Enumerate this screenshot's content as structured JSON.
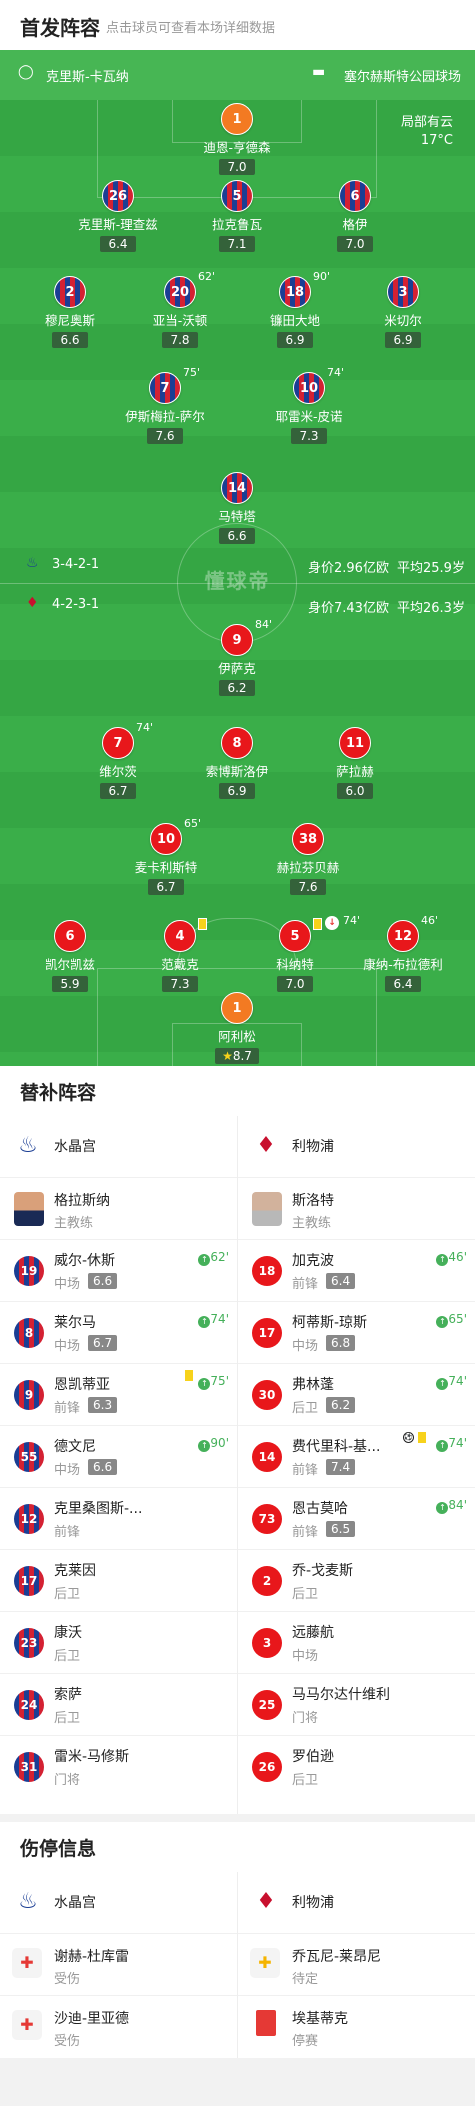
{
  "header": {
    "title": "首发阵容",
    "subtitle": "点击球员可查看本场详细数据"
  },
  "pitch": {
    "home_team": "克里斯-卡瓦纳",
    "away_team": "塞尔赫斯特公园球场",
    "weather": "局部有云",
    "temperature": "17°C",
    "watermark": "懂球帝",
    "home_formation": "3-4-2-1",
    "home_value": "身价2.96亿欧",
    "home_age": "平均25.9岁",
    "away_formation": "4-2-3-1",
    "away_value": "身价7.43亿欧",
    "away_age": "平均26.3岁",
    "home_players": [
      {
        "num": "1",
        "name": "迪恩-亨德森",
        "rating": "7.0"
      },
      {
        "num": "26",
        "name": "克里斯-理查兹",
        "rating": "6.4"
      },
      {
        "num": "5",
        "name": "拉克鲁瓦",
        "rating": "7.1"
      },
      {
        "num": "6",
        "name": "格伊",
        "rating": "7.0"
      },
      {
        "num": "2",
        "name": "穆尼奥斯",
        "rating": "6.6"
      },
      {
        "num": "20",
        "name": "亚当-沃顿",
        "rating": "7.8",
        "sub": "62'"
      },
      {
        "num": "18",
        "name": "镰田大地",
        "rating": "6.9",
        "sub": "90'"
      },
      {
        "num": "3",
        "name": "米切尔",
        "rating": "6.9"
      },
      {
        "num": "7",
        "name": "伊斯梅拉-萨尔",
        "rating": "7.6",
        "sub": "75'"
      },
      {
        "num": "10",
        "name": "耶雷米-皮诺",
        "rating": "7.3",
        "sub": "74'"
      },
      {
        "num": "14",
        "name": "马特塔",
        "rating": "6.6"
      }
    ],
    "away_players": [
      {
        "num": "9",
        "name": "伊萨克",
        "rating": "6.2",
        "sub": "84'"
      },
      {
        "num": "7",
        "name": "维尔茨",
        "rating": "6.7",
        "sub": "74'"
      },
      {
        "num": "8",
        "name": "索博斯洛伊",
        "rating": "6.9"
      },
      {
        "num": "11",
        "name": "萨拉赫",
        "rating": "6.0"
      },
      {
        "num": "10",
        "name": "麦卡利斯特",
        "rating": "6.7",
        "sub": "65'"
      },
      {
        "num": "38",
        "name": "赫拉芬贝赫",
        "rating": "7.6"
      },
      {
        "num": "6",
        "name": "凯尔凯兹",
        "rating": "5.9"
      },
      {
        "num": "4",
        "name": "范戴克",
        "rating": "7.3"
      },
      {
        "num": "5",
        "name": "科纳特",
        "rating": "7.0",
        "sub": "74'"
      },
      {
        "num": "12",
        "name": "康纳-布拉德利",
        "rating": "6.4",
        "sub": "46'"
      },
      {
        "num": "1",
        "name": "阿利松",
        "rating": "8.7"
      }
    ]
  },
  "subs": {
    "title": "替补阵容",
    "home_team": "水晶宫",
    "away_team": "利物浦",
    "home_coach": "格拉斯纳",
    "away_coach": "斯洛特",
    "coach_role": "主教练",
    "home": [
      {
        "num": "19",
        "name": "威尔-休斯",
        "pos": "中场",
        "rating": "6.6",
        "min": "62'"
      },
      {
        "num": "8",
        "name": "莱尔马",
        "pos": "中场",
        "rating": "6.7",
        "min": "74'"
      },
      {
        "num": "9",
        "name": "恩凯蒂亚",
        "pos": "前锋",
        "rating": "6.3",
        "min": "75'"
      },
      {
        "num": "55",
        "name": "德文尼",
        "pos": "中场",
        "rating": "6.6",
        "min": "90'"
      },
      {
        "num": "12",
        "name": "克里桑图斯-...",
        "pos": "前锋"
      },
      {
        "num": "17",
        "name": "克莱因",
        "pos": "后卫"
      },
      {
        "num": "23",
        "name": "康沃",
        "pos": "后卫"
      },
      {
        "num": "24",
        "name": "索萨",
        "pos": "后卫"
      },
      {
        "num": "31",
        "name": "雷米-马修斯",
        "pos": "门将"
      }
    ],
    "away": [
      {
        "num": "18",
        "name": "加克波",
        "pos": "前锋",
        "rating": "6.4",
        "min": "46'"
      },
      {
        "num": "17",
        "name": "柯蒂斯-琼斯",
        "pos": "中场",
        "rating": "6.8",
        "min": "65'"
      },
      {
        "num": "30",
        "name": "弗林蓬",
        "pos": "后卫",
        "rating": "6.2",
        "min": "74'"
      },
      {
        "num": "14",
        "name": "费代里科-基...",
        "pos": "前锋",
        "rating": "7.4",
        "min": "74'"
      },
      {
        "num": "73",
        "name": "恩古莫哈",
        "pos": "前锋",
        "rating": "6.5",
        "min": "84'"
      },
      {
        "num": "2",
        "name": "乔-戈麦斯",
        "pos": "后卫"
      },
      {
        "num": "3",
        "name": "远藤航",
        "pos": "中场"
      },
      {
        "num": "25",
        "name": "马马尔达什维利",
        "pos": "门将"
      },
      {
        "num": "26",
        "name": "罗伯逊",
        "pos": "后卫"
      }
    ]
  },
  "injuries": {
    "title": "伤停信息",
    "home_team": "水晶宫",
    "away_team": "利物浦",
    "home": [
      {
        "name": "谢赫-杜库雷",
        "status": "受伤"
      },
      {
        "name": "沙迪-里亚德",
        "status": "受伤"
      }
    ],
    "away": [
      {
        "name": "乔瓦尼-莱昂尼",
        "status": "待定"
      },
      {
        "name": "埃基蒂克",
        "status": "停赛"
      }
    ]
  },
  "colors": {
    "pitch": "#3aae49",
    "home_kit": "#1b3e94",
    "away_kit": "#e8171b",
    "gk": "#f37a22",
    "accent_green": "#45b05a"
  }
}
